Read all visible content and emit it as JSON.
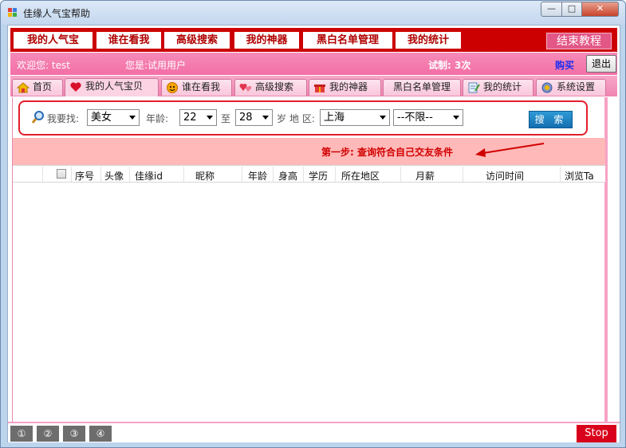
{
  "window": {
    "title": "佳缘人气宝帮助",
    "controls": {
      "minimize": "—",
      "maximize": "□",
      "close": "✕"
    }
  },
  "top_nav": {
    "items": [
      "我的人气宝",
      "谁在看我",
      "高级搜索",
      "我的神器",
      "黑白名单管理",
      "我的统计"
    ],
    "end_tutorial": "结束教程"
  },
  "welcome_bar": {
    "welcome": "欢迎您: test",
    "user_type": "您是:试用用户",
    "trial": "试制: 3次",
    "buy": "购买",
    "logout": "退出"
  },
  "tabs": [
    {
      "label": "首页",
      "icon": "home-icon"
    },
    {
      "label": "我的人气宝贝",
      "icon": "heart-icon"
    },
    {
      "label": "谁在看我",
      "icon": "face-icon"
    },
    {
      "label": "高级搜索",
      "icon": "hearts-icon"
    },
    {
      "label": "我的神器",
      "icon": "gift-icon"
    },
    {
      "label": "黑白名单管理",
      "icon": ""
    },
    {
      "label": "我的统计",
      "icon": "notepad-icon"
    },
    {
      "label": "系统设置",
      "icon": "gear-icon"
    }
  ],
  "search": {
    "find_label": "我要找:",
    "find_value": "美女",
    "age_label": "年龄:",
    "age_from": "22",
    "age_to_label": "至",
    "age_to": "28",
    "age_unit": "岁",
    "region_label": "地 区:",
    "region_value": "上海",
    "region_sub": "--不限--",
    "search_button": "搜 索"
  },
  "hint": "第一步: 查询符合自己交友条件",
  "table": {
    "columns": [
      "序号",
      "头像",
      "佳缘id",
      "昵称",
      "年龄",
      "身高",
      "学历",
      "所在地区",
      "月薪",
      "访问时间",
      "浏览Ta"
    ],
    "rows": []
  },
  "bottom": {
    "steps": [
      "①",
      "②",
      "③",
      "④"
    ],
    "stop": "Stop"
  },
  "colors": {
    "nav_red": "#cc0000",
    "pink": "#f36fa6",
    "hint_bg": "#ffb9b9",
    "accent_blue": "#136fb0"
  }
}
